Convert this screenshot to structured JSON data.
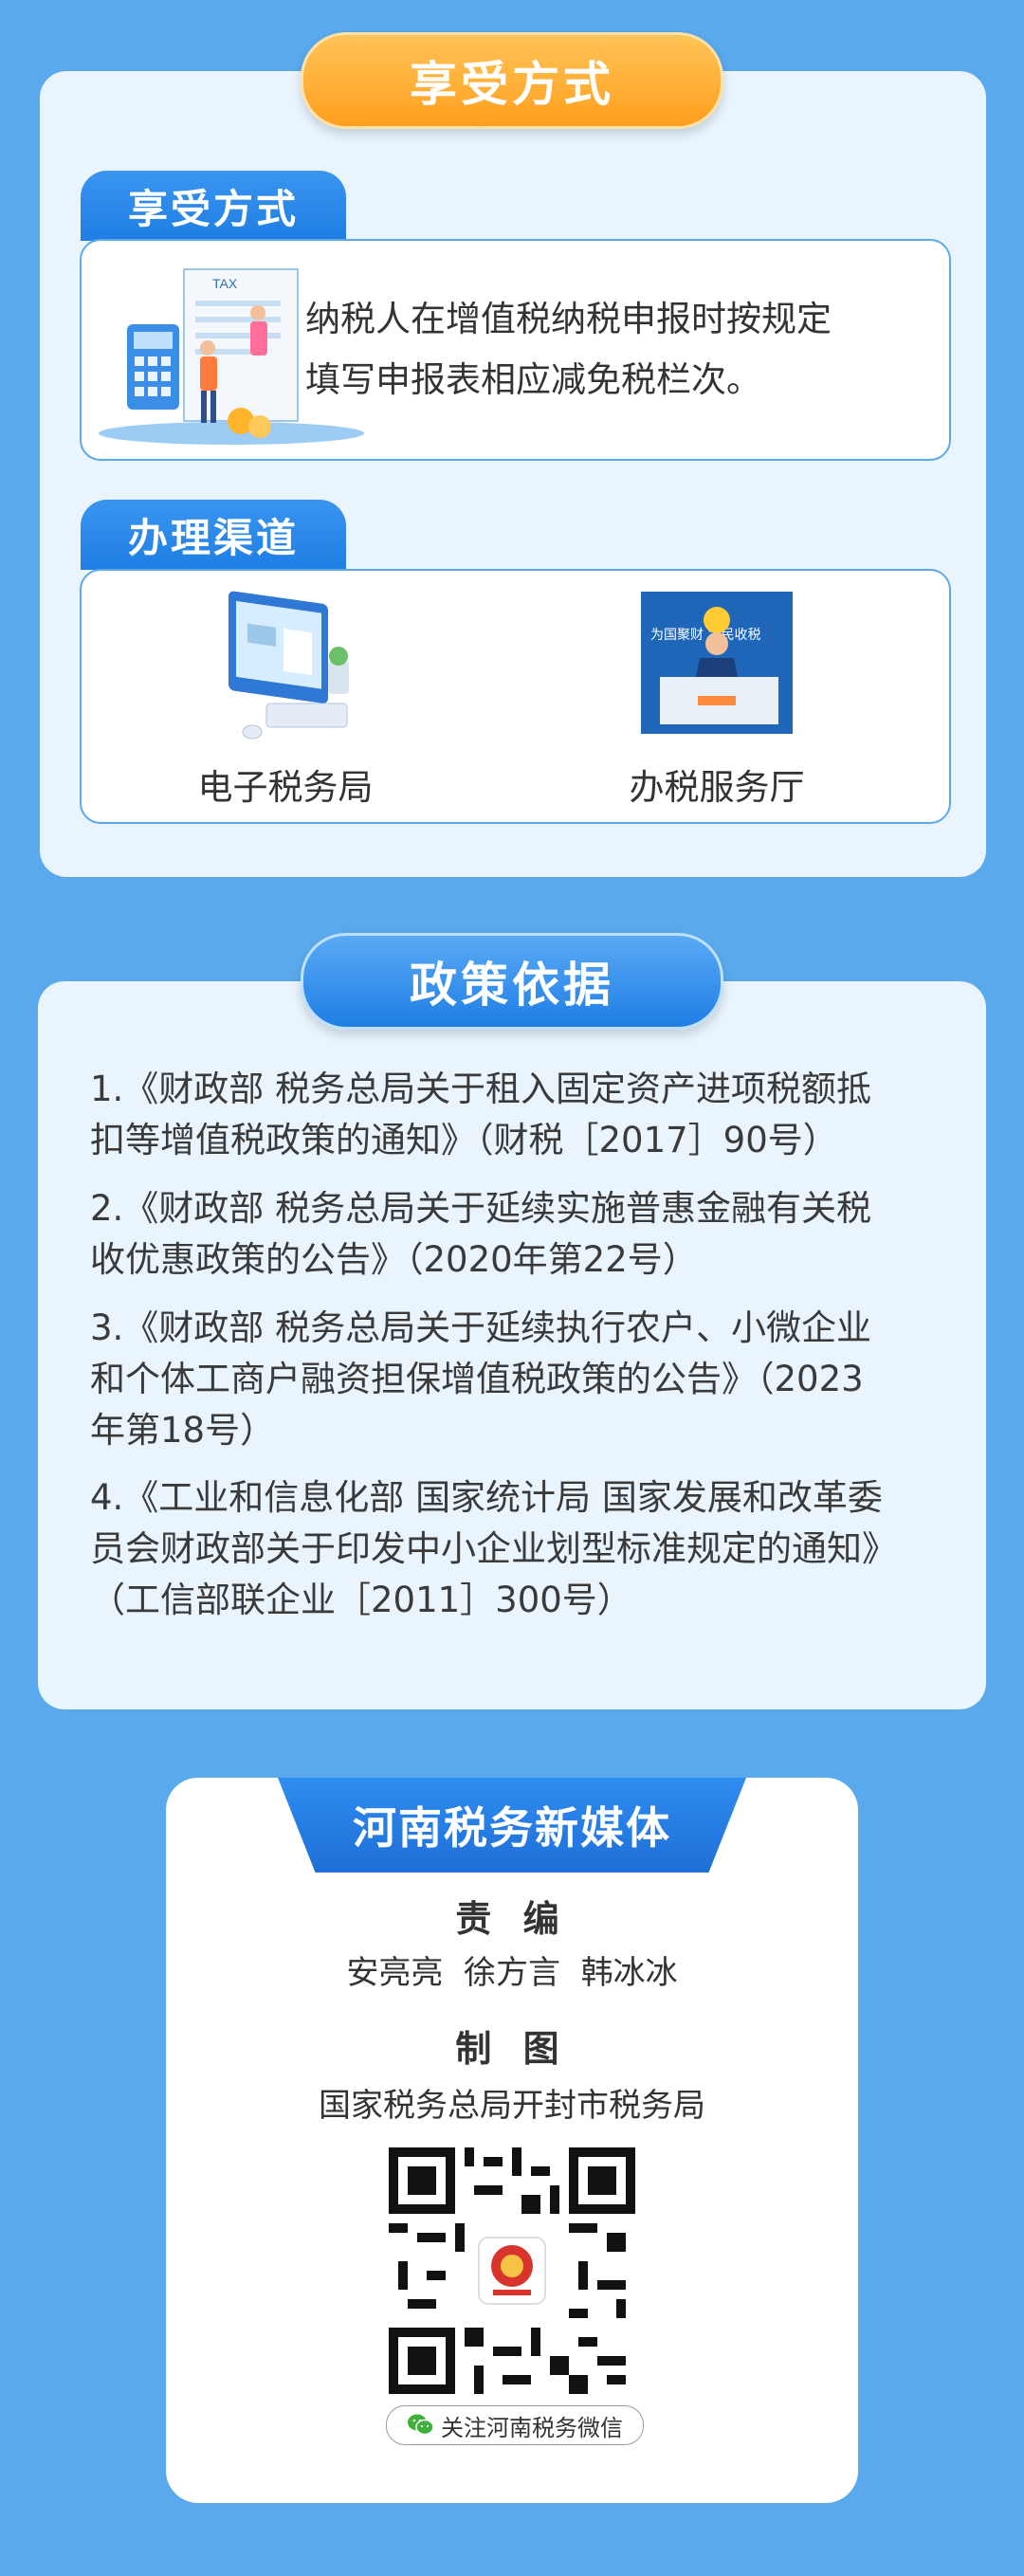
{
  "section1": {
    "header": "享受方式",
    "method_tab": "享受方式",
    "method_text_line1": "纳税人在增值税纳税申报时按规定",
    "method_text_line2": "填写申报表相应减免税栏次。",
    "illustration_label": "TAX",
    "channel_tab": "办理渠道",
    "channels": [
      {
        "label": "电子税务局",
        "icon": "computer-icon"
      },
      {
        "label": "办税服务厅",
        "icon": "service-hall-icon",
        "sign": "为国聚财 为民收税"
      }
    ]
  },
  "section2": {
    "header": "政策依据",
    "items": [
      {
        "line1": "1.《财政部 税务总局关于租入固定资产进项税额抵",
        "line2": "扣等增值税政策的通知》（财税［2017］90号）"
      },
      {
        "line1": "2.《财政部 税务总局关于延续实施普惠金融有关税",
        "line2": "收优惠政策的公告》（2020年第22号）"
      },
      {
        "line1": "3.《财政部 税务总局关于延续执行农户、小微企业",
        "line2": "和个体工商户融资担保增值税政策的公告》（2023",
        "line3": "年第18号）"
      },
      {
        "line1": "4.《工业和信息化部 国家统计局 国家发展和改革委",
        "line2": "员会财政部关于印发中小企业划型标准规定的通知》",
        "line3": "（工信部联企业［2011］300号）"
      }
    ]
  },
  "credits": {
    "title": "河南税务新媒体",
    "editor_label": "责 编",
    "editors": "安亮亮  徐方言  韩冰冰",
    "design_label": "制 图",
    "designer": "国家税务总局开封市税务局",
    "qr_icon": "qr-code-icon",
    "follow_label": "关注河南税务微信"
  },
  "colors": {
    "background": "#5aa9ec",
    "card": "#e9f4fd",
    "accent_blue": "#1f7ee4",
    "accent_orange": "#ff9f1f"
  }
}
